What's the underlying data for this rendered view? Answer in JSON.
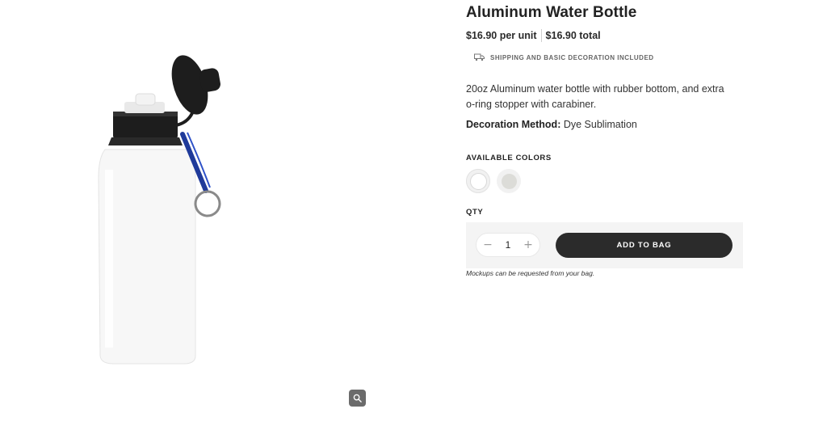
{
  "product": {
    "title": "Aluminum Water Bottle",
    "price_unit": "$16.90 per unit",
    "price_total": "$16.90 total",
    "shipping_note": "SHIPPING AND BASIC DECORATION INCLUDED",
    "description": "20oz Aluminum water bottle with rubber bottom, and extra o-ring stopper with carabiner.",
    "decoration_label": "Decoration Method:",
    "decoration_value": "Dye Sublimation"
  },
  "colors": {
    "label": "AVAILABLE COLORS",
    "options": [
      {
        "name": "white",
        "hex": "#ffffff",
        "selected": true
      },
      {
        "name": "silver",
        "hex": "#dcdcd8",
        "selected": false
      }
    ]
  },
  "quantity": {
    "label": "QTY",
    "value": "1",
    "minus_symbol": "−",
    "plus_symbol": "+"
  },
  "cart": {
    "add_button_label": "ADD TO BAG",
    "mockup_note": "Mockups can be requested from your bag."
  },
  "theme": {
    "accent": "#2b2b2b",
    "panel_bg": "#f4f4f4"
  },
  "icons": {
    "shipping": "truck-icon",
    "zoom": "magnifier-icon"
  }
}
